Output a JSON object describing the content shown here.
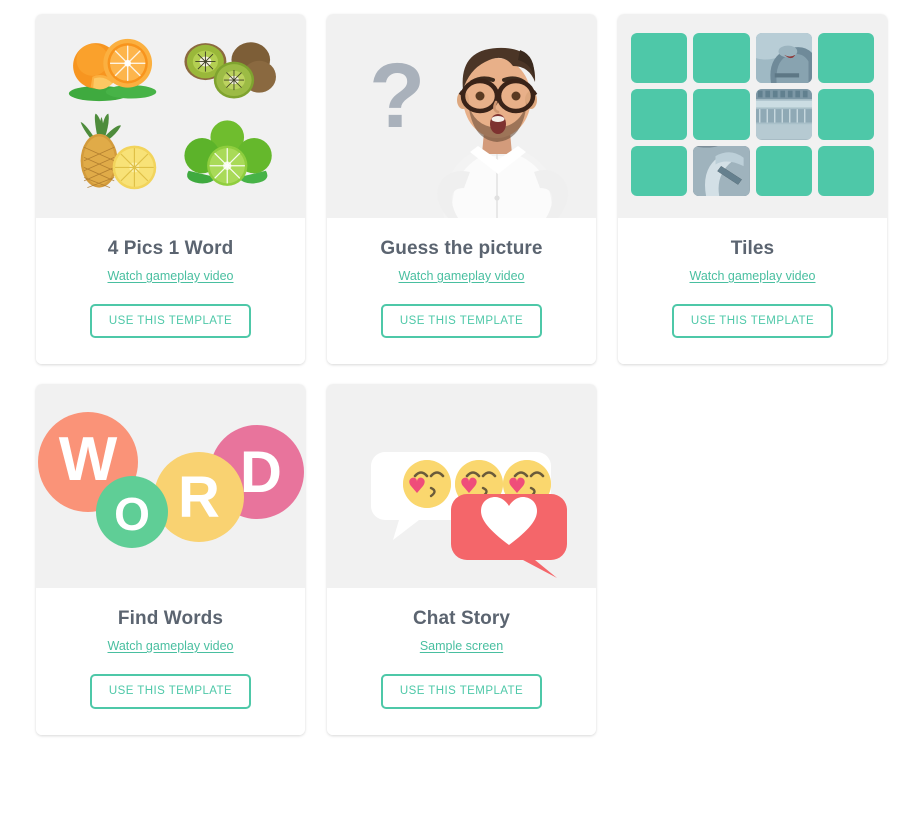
{
  "page": {
    "background_color": "#ffffff",
    "accent_color": "#4ec8a8",
    "link_color": "#49bfa0",
    "title_color": "#5b6470",
    "media_background": "#f1f1f1"
  },
  "templates": [
    {
      "id": "four-pics-one-word",
      "title": "4 Pics 1 Word",
      "link_label": "Watch gameplay video",
      "button_label": "USE THIS TEMPLATE",
      "thumbnail": {
        "kind": "fruit-collage",
        "items": [
          "oranges",
          "kiwis",
          "pineapple",
          "limes"
        ]
      }
    },
    {
      "id": "guess-the-picture",
      "title": "Guess the picture",
      "link_label": "Watch gameplay video",
      "button_label": "USE THIS TEMPLATE",
      "thumbnail": {
        "kind": "question-mark-photo",
        "question_mark": "?",
        "subject": "surprised man with glasses"
      }
    },
    {
      "id": "tiles",
      "title": "Tiles",
      "link_label": "Watch gameplay video",
      "button_label": "USE THIS TEMPLATE",
      "thumbnail": {
        "kind": "tile-grid",
        "columns": 4,
        "rows": 3,
        "tile_color": "#4ec8a8",
        "revealed_cells": [
          3,
          7,
          10
        ]
      }
    },
    {
      "id": "find-words",
      "title": "Find Words",
      "link_label": "Watch gameplay video",
      "button_label": "USE THIS TEMPLATE",
      "thumbnail": {
        "kind": "word-circles",
        "letters": [
          "W",
          "O",
          "R",
          "D"
        ],
        "circle_colors": [
          "#fa9378",
          "#5fce96",
          "#f9d271",
          "#e8749c"
        ]
      }
    },
    {
      "id": "chat-story",
      "title": "Chat Story",
      "link_label": "Sample screen",
      "button_label": "USE THIS TEMPLATE",
      "thumbnail": {
        "kind": "chat-bubbles",
        "emoji_count": 3,
        "bubble_colors": [
          "#ffffff",
          "#f4666a"
        ]
      }
    }
  ]
}
